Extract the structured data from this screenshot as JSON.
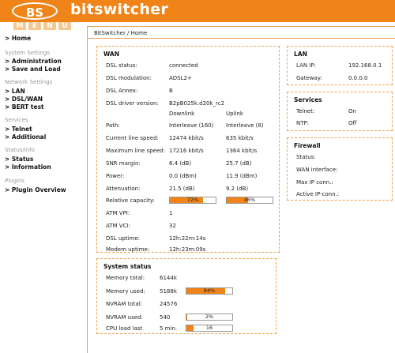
{
  "header": {
    "logo": "BS",
    "brand": "bitswitcher",
    "menu_letters": [
      "M",
      "E",
      "N",
      "U"
    ]
  },
  "sidebar": {
    "items": [
      {
        "type": "link",
        "label": "> Home"
      },
      {
        "type": "head",
        "label": "System Settings"
      },
      {
        "type": "link",
        "label": "> Administration"
      },
      {
        "type": "link",
        "label": "> Save and Load"
      },
      {
        "type": "head",
        "label": "Network Settings"
      },
      {
        "type": "link",
        "label": "> LAN"
      },
      {
        "type": "link",
        "label": "> DSL/WAN"
      },
      {
        "type": "link",
        "label": "> BERT test"
      },
      {
        "type": "head",
        "label": "Services"
      },
      {
        "type": "link",
        "label": "> Telnet"
      },
      {
        "type": "link",
        "label": "> Additional"
      },
      {
        "type": "head",
        "label": "Status/Info"
      },
      {
        "type": "link",
        "label": "> Status"
      },
      {
        "type": "link",
        "label": "> Information"
      },
      {
        "type": "head",
        "label": "Plugins"
      },
      {
        "type": "link",
        "label": "> Plugin Overview"
      }
    ]
  },
  "breadcrumb": "BitSwitcher / Home",
  "wan": {
    "title": "WAN",
    "dsl_status": {
      "label": "DSL status:",
      "value": "connected"
    },
    "dsl_modulation": {
      "label": "DSL modulation:",
      "value": "ADSL2+"
    },
    "dsl_annex": {
      "label": "DSL Annex:",
      "value": "B"
    },
    "dsl_driver": {
      "label": "DSL driver version:",
      "value": "B2pB025k.d20k_rc2"
    },
    "col_down": "Downlink",
    "col_up": "Uplink",
    "path": {
      "label": "Path:",
      "down": "Interleave (160)",
      "up": "Interleave (8)"
    },
    "current_speed": {
      "label": "Current line speed:",
      "down": "12474 kbit/s",
      "up": "635 kbit/s"
    },
    "max_speed": {
      "label": "Maximum line speed:",
      "down": "17216 kbit/s",
      "up": "1364 kbit/s"
    },
    "snr": {
      "label": "SNR margin:",
      "down": "6.4 (dB)",
      "up": "25.7 (dB)"
    },
    "power": {
      "label": "Power:",
      "down": "0.0 (dBm)",
      "up": "11.9 (dBm)"
    },
    "attenuation": {
      "label": "Attenuation:",
      "down": "21.5 (dB)",
      "up": "9.2 (dB)"
    },
    "capacity": {
      "label": "Relative capacity:",
      "down_text": "72%",
      "down_level": 0.72,
      "up_text": "46%",
      "up_level": 0.46
    },
    "atm_vpi": {
      "label": "ATM VPI:",
      "value": "1"
    },
    "atm_vci": {
      "label": "ATM VCI:",
      "value": "32"
    },
    "dsl_uptime": {
      "label": "DSL uptime:",
      "value": "12h:22m:14s"
    },
    "modem_uptime": {
      "label": "Modem uptime:",
      "value": "12h:23m:09s"
    }
  },
  "system": {
    "title": "System status",
    "mem_total": {
      "label": "Memory total:",
      "value": "6144k"
    },
    "mem_used": {
      "label": "Memory used:",
      "value": "5188k",
      "bar_text": "84%",
      "level": 0.84
    },
    "nvram_total": {
      "label": "NVRAM total:",
      "value": "24576"
    },
    "nvram_used": {
      "label": "NVRAM used:",
      "value": "540",
      "bar_text": "2%",
      "level": 0.02
    },
    "cpu_load": {
      "label": "CPU load last",
      "value": "5 min.",
      "bar_text": "16",
      "level": 0.16
    }
  },
  "lan": {
    "title": "LAN",
    "ip": {
      "label": "LAN IP:",
      "value": "192.168.0.1"
    },
    "gateway": {
      "label": "Gateway:",
      "value": "0.0.0.0"
    }
  },
  "services": {
    "title": "Services",
    "telnet": {
      "label": "Telnet:",
      "value": "On"
    },
    "ntp": {
      "label": "NTP:",
      "value": "Off"
    }
  },
  "firewall": {
    "title": "Firewall",
    "status": {
      "label": "Status:",
      "value": ""
    },
    "wan_iface": {
      "label": "WAN interface:",
      "value": ""
    },
    "max_ip": {
      "label": "Max IP conn.:",
      "value": ""
    },
    "active_ip": {
      "label": "Active IP-conn.:",
      "value": ""
    }
  },
  "colors": {
    "accent": "#f08418",
    "menu_letter_bg": "#f4c890",
    "box_border": "#f0a050"
  }
}
